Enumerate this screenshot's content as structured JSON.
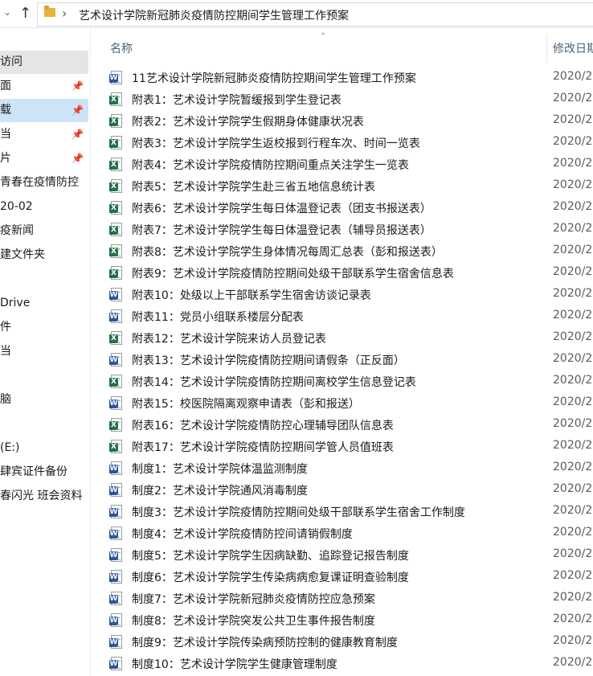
{
  "address": {
    "breadcrumb_sep": "›",
    "path": "艺术设计学院新冠肺炎疫情防控期间学生管理工作预案"
  },
  "sidebar": {
    "items": [
      {
        "label": "访问",
        "pinned": false,
        "state": "hover"
      },
      {
        "label": "面",
        "pinned": true,
        "state": ""
      },
      {
        "label": "载",
        "pinned": true,
        "state": "selected"
      },
      {
        "label": "当",
        "pinned": true,
        "state": ""
      },
      {
        "label": "片",
        "pinned": true,
        "state": ""
      },
      {
        "label": "青春在疫情防控",
        "pinned": false,
        "state": ""
      },
      {
        "label": "20-02",
        "pinned": false,
        "state": ""
      },
      {
        "label": "疫新闻",
        "pinned": false,
        "state": ""
      },
      {
        "label": "建文件夹",
        "pinned": false,
        "state": ""
      },
      {
        "label": "",
        "pinned": false,
        "state": ""
      },
      {
        "label": "Drive",
        "pinned": false,
        "state": ""
      },
      {
        "label": "件",
        "pinned": false,
        "state": ""
      },
      {
        "label": "当",
        "pinned": false,
        "state": ""
      },
      {
        "label": "",
        "pinned": false,
        "state": ""
      },
      {
        "label": "脑",
        "pinned": false,
        "state": ""
      },
      {
        "label": "",
        "pinned": false,
        "state": ""
      },
      {
        "label": " (E:)",
        "pinned": false,
        "state": ""
      },
      {
        "label": "肆宾证件备份",
        "pinned": false,
        "state": ""
      },
      {
        "label": "春闪光 班会资料",
        "pinned": false,
        "state": ""
      }
    ]
  },
  "columns": {
    "name": "名称",
    "modified": "修改日期"
  },
  "files": [
    {
      "type": "word",
      "name": "11艺术设计学院新冠肺炎疫情防控期间学生管理工作预案",
      "date": "2020/2"
    },
    {
      "type": "excel",
      "name": "附表1：艺术设计学院暂缓报到学生登记表",
      "date": "2020/2"
    },
    {
      "type": "excel",
      "name": "附表2：艺术设计学院学生假期身体健康状况表",
      "date": "2020/2"
    },
    {
      "type": "excel",
      "name": "附表3：艺术设计学院学生返校报到行程车次、时间一览表",
      "date": "2020/2"
    },
    {
      "type": "excel",
      "name": "附表4：艺术设计学院疫情防控期间重点关注学生一览表",
      "date": "2020/2"
    },
    {
      "type": "excel",
      "name": "附表5：艺术设计学院学生赴三省五地信息统计表",
      "date": "2020/2"
    },
    {
      "type": "excel",
      "name": "附表6：艺术设计学院学生每日体温登记表（团支书报送表）",
      "date": "2020/2"
    },
    {
      "type": "excel",
      "name": "附表7：艺术设计学院学生每日体温登记表（辅导员报送表）",
      "date": "2020/2"
    },
    {
      "type": "excel",
      "name": "附表8：艺术设计学院学生身体情况每周汇总表（彭和报送表）",
      "date": "2020/2"
    },
    {
      "type": "excel",
      "name": "附表9：艺术设计学院疫情防控期间处级干部联系学生宿舍信息表",
      "date": "2020/2"
    },
    {
      "type": "word",
      "name": "附表10：处级以上干部联系学生宿舍访谈记录表",
      "date": "2020/2"
    },
    {
      "type": "word",
      "name": "附表11：党员小组联系楼层分配表",
      "date": "2020/2"
    },
    {
      "type": "excel",
      "name": "附表12：艺术设计学院来访人员登记表",
      "date": "2020/2"
    },
    {
      "type": "word",
      "name": "附表13：艺术设计学院疫情防控期间请假条（正反面）",
      "date": "2020/2"
    },
    {
      "type": "excel",
      "name": "附表14：艺术设计学院疫情防控期间离校学生信息登记表",
      "date": "2020/2"
    },
    {
      "type": "word",
      "name": "附表15：校医院隔离观察申请表（彭和报送）",
      "date": "2020/2"
    },
    {
      "type": "excel",
      "name": "附表16：艺术设计学院疫情防控心理辅导团队信息表",
      "date": "2020/2"
    },
    {
      "type": "excel",
      "name": "附表17：艺术设计学院疫情防控期间学管人员值班表",
      "date": "2020/2"
    },
    {
      "type": "word",
      "name": "制度1：艺术设计学院体温监测制度",
      "date": "2020/2"
    },
    {
      "type": "word",
      "name": "制度2：艺术设计学院通风消毒制度",
      "date": "2020/2"
    },
    {
      "type": "word",
      "name": "制度3：艺术设计学院疫情防控期间处级干部联系学生宿舍工作制度",
      "date": "2020/2"
    },
    {
      "type": "word",
      "name": "制度4：艺术设计学院疫情防控间请销假制度",
      "date": "2020/2"
    },
    {
      "type": "word",
      "name": "制度5：艺术设计学院学生因病缺勤、追踪登记报告制度",
      "date": "2020/2"
    },
    {
      "type": "word",
      "name": "制度6：艺术设计学院学生传染病病愈复课证明查验制度",
      "date": "2020/2"
    },
    {
      "type": "word",
      "name": "制度7：艺术设计学院新冠肺炎疫情防控应急预案",
      "date": "2020/2"
    },
    {
      "type": "word",
      "name": "制度8：艺术设计学院突发公共卫生事件报告制度",
      "date": "2020/2"
    },
    {
      "type": "word",
      "name": "制度9：艺术设计学院传染病预防控制的健康教育制度",
      "date": "2020/2"
    },
    {
      "type": "word",
      "name": "制度10：艺术设计学院学生健康管理制度",
      "date": "2020/2"
    }
  ]
}
